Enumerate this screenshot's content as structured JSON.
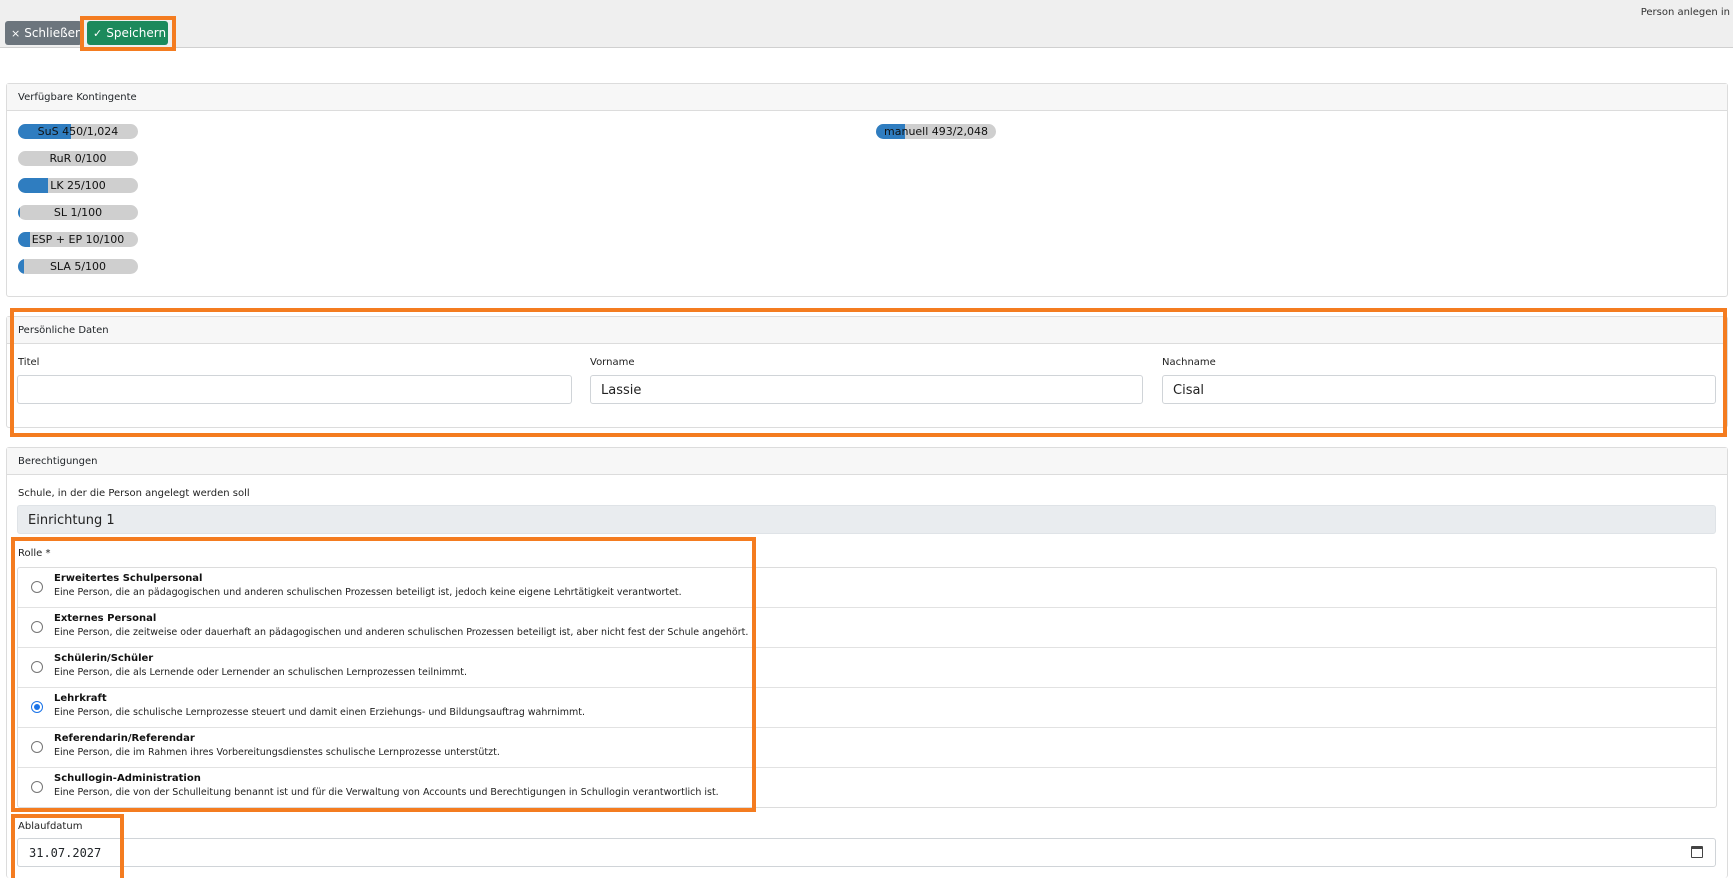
{
  "header": {
    "page_title": "Person anlegen in",
    "close_label": "Schließen",
    "save_label": "Speichern",
    "close_icon": "×",
    "save_icon": "✓"
  },
  "quotas": {
    "title": "Verfügbare Kontingente",
    "items": [
      {
        "label": "SuS 450/1,024",
        "fraction": 0.439
      },
      {
        "label": "RuR 0/100",
        "fraction": 0.0
      },
      {
        "label": "LK 25/100",
        "fraction": 0.25
      },
      {
        "label": "SL 1/100",
        "fraction": 0.01
      },
      {
        "label": "ESP + EP 10/100",
        "fraction": 0.1
      },
      {
        "label": "SLA 5/100",
        "fraction": 0.05
      },
      {
        "label": "manuell 493/2,048",
        "fraction": 0.241
      }
    ]
  },
  "personal": {
    "title": "Persönliche Daten",
    "titel_label": "Titel",
    "titel_value": "",
    "vorname_label": "Vorname",
    "vorname_value": "Lassie",
    "nachname_label": "Nachname",
    "nachname_value": "Cisal"
  },
  "permissions": {
    "title": "Berechtigungen",
    "school_label": "Schule, in der die Person angelegt werden soll",
    "school_value": "Einrichtung 1",
    "role_label": "Rolle *",
    "roles": [
      {
        "title": "Erweitertes Schulpersonal",
        "desc": "Eine Person, die an pädagogischen und anderen schulischen Prozessen beteiligt ist, jedoch keine eigene Lehrtätigkeit verantwortet.",
        "selected": false
      },
      {
        "title": "Externes Personal",
        "desc": "Eine Person, die zeitweise oder dauerhaft an pädagogischen und anderen schulischen Prozessen beteiligt ist, aber nicht fest der Schule angehört.",
        "selected": false
      },
      {
        "title": "Schülerin/Schüler",
        "desc": "Eine Person, die als Lernende oder Lernender an schulischen Lernprozessen teilnimmt.",
        "selected": false
      },
      {
        "title": "Lehrkraft",
        "desc": "Eine Person, die schulische Lernprozesse steuert und damit einen Erziehungs- und Bildungsauftrag wahrnimmt.",
        "selected": true
      },
      {
        "title": "Referendarin/Referendar",
        "desc": "Eine Person, die im Rahmen ihres Vorbereitungsdienstes schulische Lernprozesse unterstützt.",
        "selected": false
      },
      {
        "title": "Schullogin-Administration",
        "desc": "Eine Person, die von der Schulleitung benannt ist und für die Verwaltung von Accounts und Berechtigungen in Schullogin verantwortlich ist.",
        "selected": false
      }
    ],
    "expiry_label": "Ablaufdatum",
    "expiry_value": "31.07.2027"
  },
  "colors": {
    "highlight": "#f47c20",
    "save_green": "#1c8a5c",
    "quota_fill": "#2f7dc0"
  }
}
